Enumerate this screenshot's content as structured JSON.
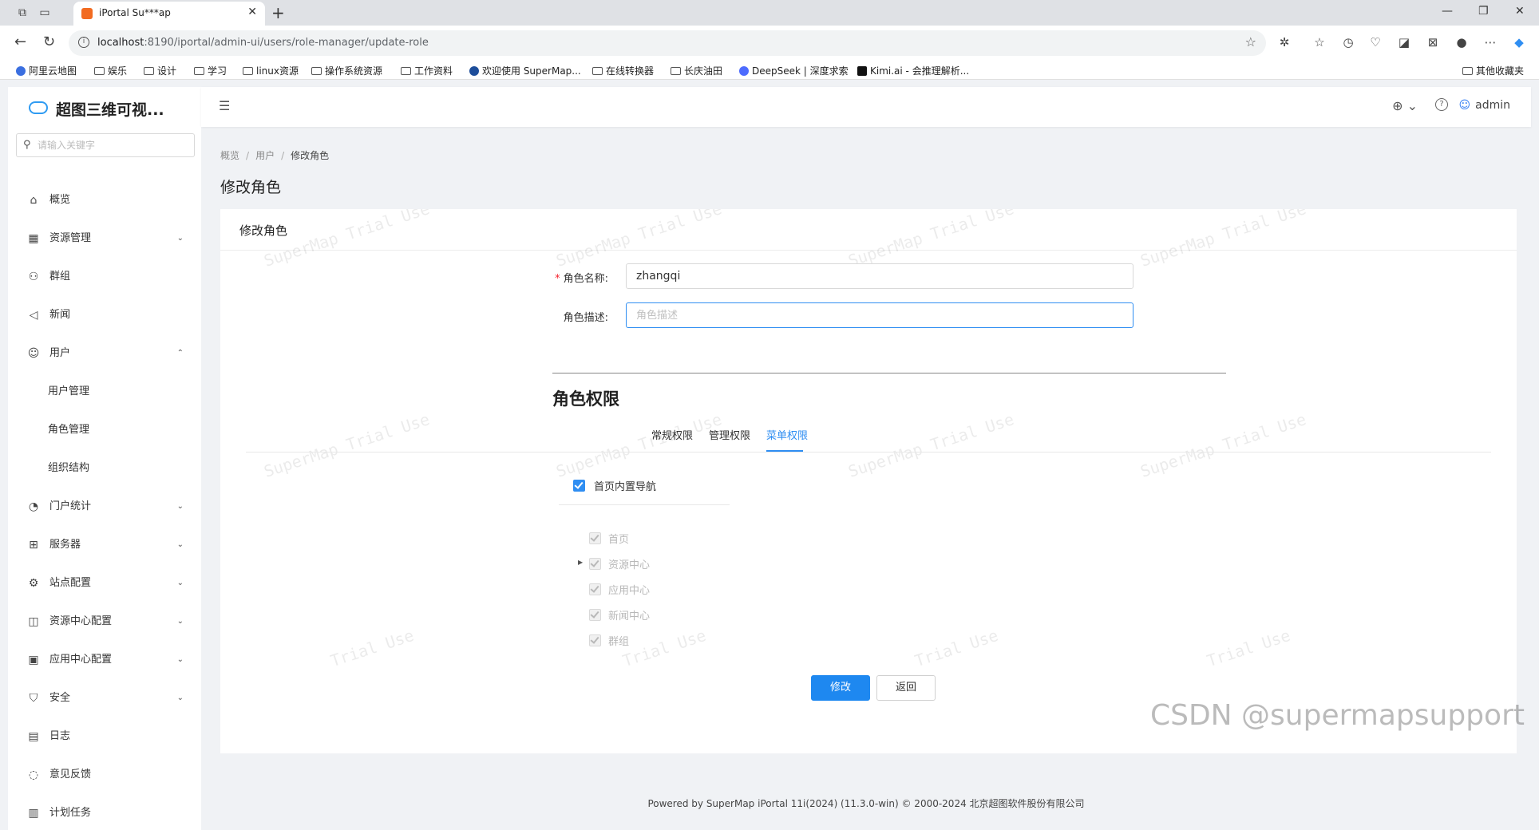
{
  "browser": {
    "tab_title": "iPortal Su***ap",
    "url_host": "localhost",
    "url_path": ":8190/iportal/admin-ui/users/role-manager/update-role",
    "bookmarks": [
      "阿里云地图",
      "娱乐",
      "设计",
      "学习",
      "linux资源",
      "操作系统资源",
      "工作资料",
      "欢迎使用 SuperMap...",
      "在线转换器",
      "长庆油田",
      "DeepSeek | 深度求索",
      "Kimi.ai - 会推理解析...",
      "其他收藏夹"
    ]
  },
  "sidebar": {
    "app_name": "超图三维可视...",
    "search_placeholder": "请输入关键字",
    "items": [
      {
        "label": "概览",
        "icon": "home-icon"
      },
      {
        "label": "资源管理",
        "icon": "table-icon"
      },
      {
        "label": "群组",
        "icon": "group-icon"
      },
      {
        "label": "新闻",
        "icon": "megaphone-icon"
      },
      {
        "label": "用户",
        "icon": "user-icon"
      },
      {
        "label": "用户管理"
      },
      {
        "label": "角色管理"
      },
      {
        "label": "组织结构"
      },
      {
        "label": "门户统计",
        "icon": "dashboard-icon"
      },
      {
        "label": "服务器",
        "icon": "server-icon"
      },
      {
        "label": "站点配置",
        "icon": "gear-icon"
      },
      {
        "label": "资源中心配置",
        "icon": "blocks-icon"
      },
      {
        "label": "应用中心配置",
        "icon": "apps-icon"
      },
      {
        "label": "安全",
        "icon": "shield-icon"
      },
      {
        "label": "日志",
        "icon": "log-icon"
      },
      {
        "label": "意见反馈",
        "icon": "feedback-icon"
      },
      {
        "label": "计划任务",
        "icon": "calendar-icon"
      }
    ]
  },
  "header": {
    "username": "admin"
  },
  "breadcrumb": [
    "概览",
    "用户",
    "修改角色"
  ],
  "page_title": "修改角色",
  "card_title": "修改角色",
  "form": {
    "name_label": "角色名称:",
    "name_value": "zhangqi",
    "desc_label": "角色描述:",
    "desc_placeholder": "角色描述"
  },
  "permissions": {
    "title": "角色权限",
    "tabs": [
      "常规权限",
      "管理权限",
      "菜单权限"
    ],
    "active_tab": "菜单权限",
    "root_node": "首页内置导航",
    "nodes": [
      "首页",
      "资源中心",
      "应用中心",
      "新闻中心",
      "群组"
    ]
  },
  "buttons": {
    "submit": "修改",
    "back": "返回"
  },
  "watermark": "SuperMap Trial Use",
  "watermark_partial": "Trial Use",
  "footer": "Powered by SuperMap iPortal 11i(2024) (11.3.0-win) © 2000-2024 北京超图软件股份有限公司",
  "overlay_text": "CSDN @supermapsupport",
  "colors": {
    "accent": "#2f8ef2",
    "required": "#f5222d"
  }
}
